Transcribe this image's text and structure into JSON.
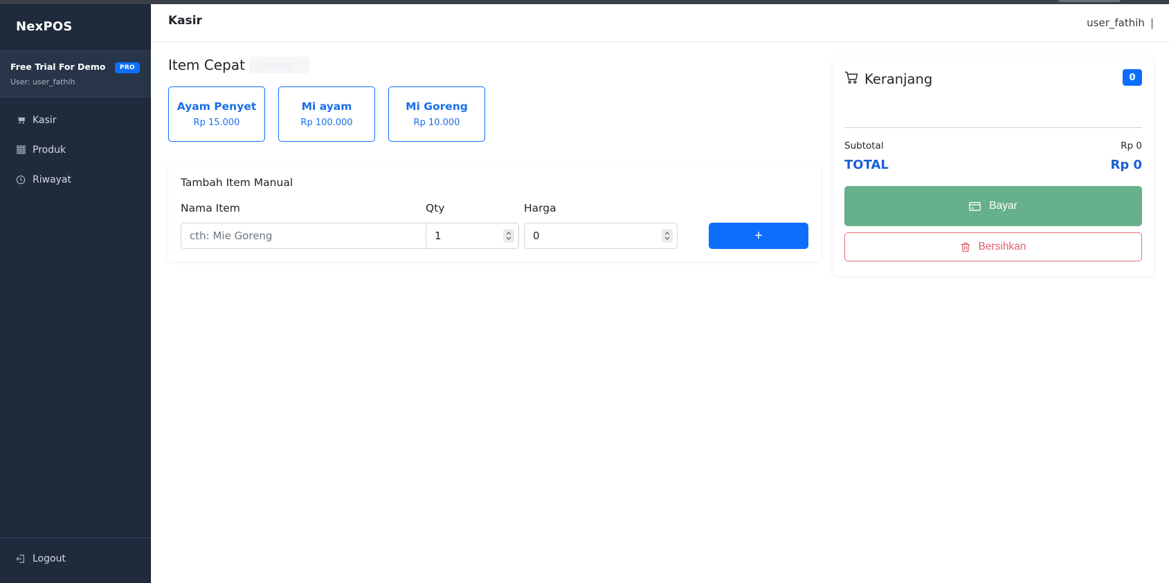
{
  "sidebar": {
    "brand": "NexPOS",
    "trial": {
      "title": "Free Trial For Demo",
      "badge": "PRO",
      "user": "User: user_fathih"
    },
    "items": [
      {
        "label": "Kasir",
        "icon": "cart-icon"
      },
      {
        "label": "Produk",
        "icon": "grid-icon"
      },
      {
        "label": "Riwayat",
        "icon": "clock-icon"
      }
    ],
    "logout_label": "Logout"
  },
  "header": {
    "title": "Kasir",
    "username": "user_fathih",
    "separator": "|"
  },
  "quick": {
    "title": "Item Cepat",
    "loading": "Loading...",
    "items": [
      {
        "name": "Ayam Penyet",
        "price": "Rp 15.000"
      },
      {
        "name": "Mi ayam",
        "price": "Rp 100.000"
      },
      {
        "name": "Mi Goreng",
        "price": "Rp 10.000"
      }
    ]
  },
  "manual": {
    "title": "Tambah Item Manual",
    "name_label": "Nama Item",
    "name_placeholder": "cth: Mie Goreng",
    "qty_label": "Qty",
    "qty_value": "1",
    "price_label": "Harga",
    "price_value": "0",
    "add_label": "+"
  },
  "cart": {
    "title": "Keranjang",
    "count": "0",
    "subtotal_label": "Subtotal",
    "subtotal_value": "Rp 0",
    "total_label": "TOTAL",
    "total_value": "Rp 0",
    "pay_label": "Bayar",
    "clear_label": "Bersihkan"
  },
  "colors": {
    "sidebar_bg": "#1f2a3c",
    "primary": "#0d6efd",
    "pay": "#67b08c",
    "danger": "#e35d6a"
  }
}
